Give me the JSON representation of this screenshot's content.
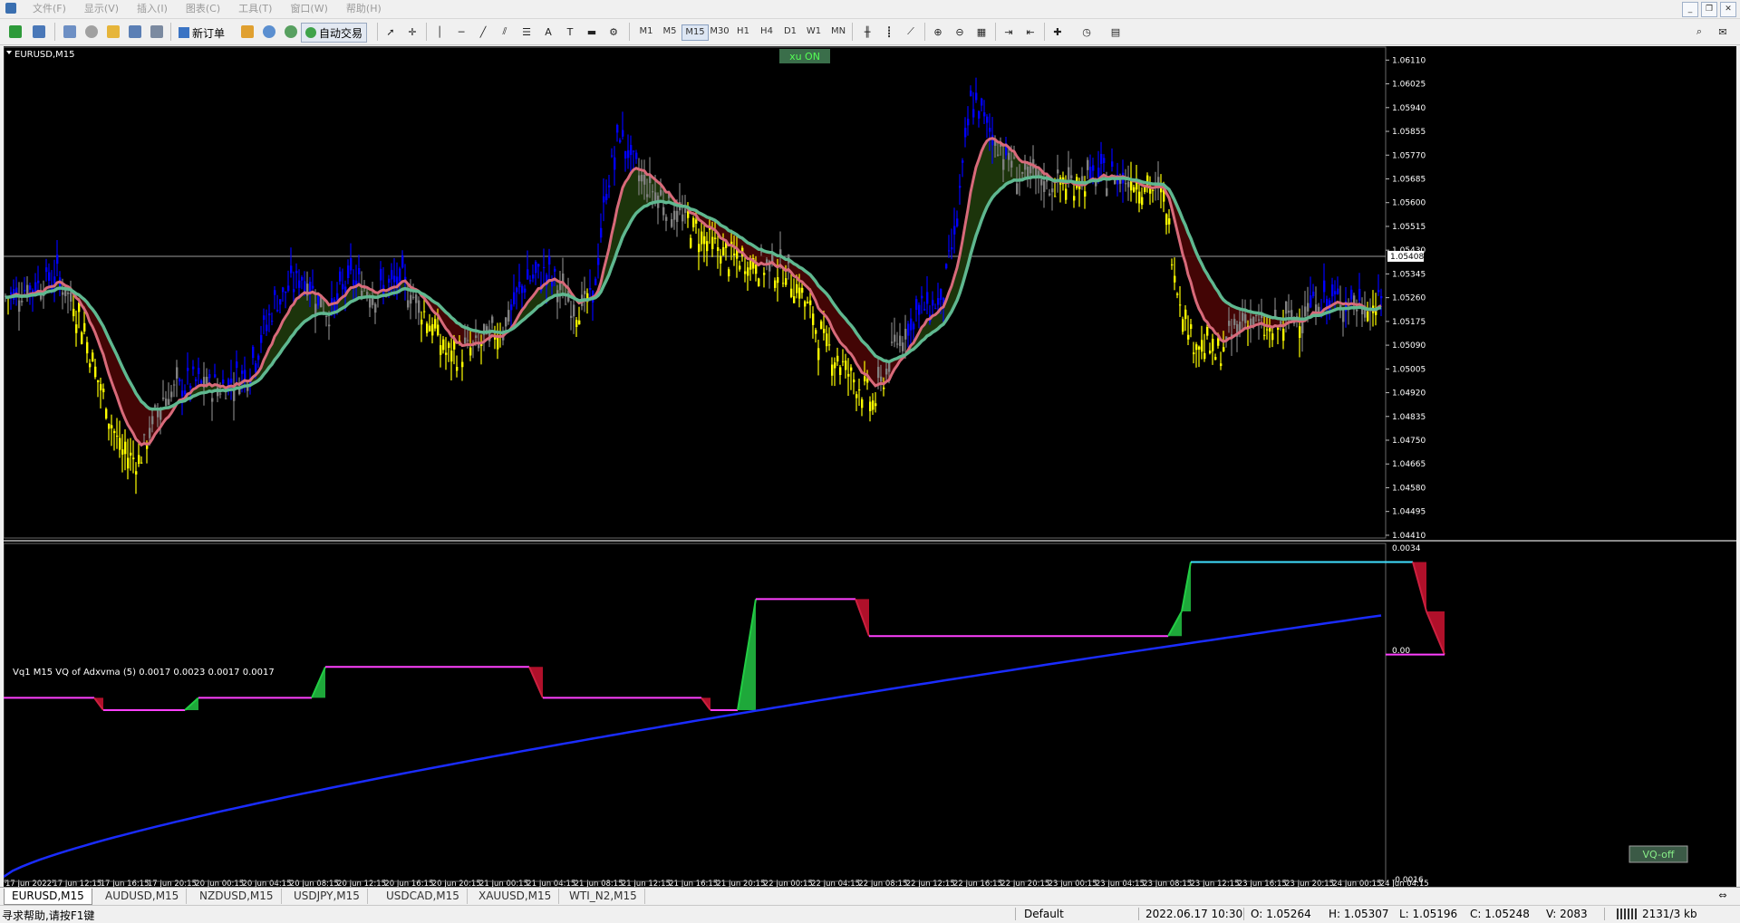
{
  "menu": [
    "文件(F)",
    "显示(V)",
    "插入(I)",
    "图表(C)",
    "工具(T)",
    "窗口(W)",
    "帮助(H)"
  ],
  "toolbar": {
    "new_order": "新订单",
    "auto_trading": "自动交易",
    "timeframes": [
      "M1",
      "M5",
      "M15",
      "M30",
      "H1",
      "H4",
      "D1",
      "W1",
      "MN"
    ],
    "active_timeframe": "M15"
  },
  "chart": {
    "symbol_label": "EURUSD,M15",
    "ea_badge": "xu ON",
    "current_price": "1.05408",
    "price_ticks": [
      "1.06110",
      "1.06025",
      "1.05940",
      "1.05855",
      "1.05770",
      "1.05685",
      "1.05600",
      "1.05515",
      "1.05430",
      "1.05345",
      "1.05260",
      "1.05175",
      "1.05090",
      "1.05005",
      "1.04920",
      "1.04835",
      "1.04750",
      "1.04665",
      "1.04580",
      "1.04495",
      "1.04410"
    ],
    "time_ticks": [
      "17 Jun 2022",
      "17 Jun 12:15",
      "17 Jun 16:15",
      "17 Jun 20:15",
      "20 Jun 00:15",
      "20 Jun 04:15",
      "20 Jun 08:15",
      "20 Jun 12:15",
      "20 Jun 16:15",
      "20 Jun 20:15",
      "21 Jun 00:15",
      "21 Jun 04:15",
      "21 Jun 08:15",
      "21 Jun 12:15",
      "21 Jun 16:15",
      "21 Jun 20:15",
      "22 Jun 00:15",
      "22 Jun 04:15",
      "22 Jun 08:15",
      "22 Jun 12:15",
      "22 Jun 16:15",
      "22 Jun 20:15",
      "23 Jun 00:15",
      "23 Jun 04:15",
      "23 Jun 08:15",
      "23 Jun 12:15",
      "23 Jun 16:15",
      "23 Jun 20:15",
      "24 Jun 00:15",
      "24 Jun 04:15"
    ],
    "colors": {
      "bull": "#0000ff",
      "bear": "#ffff00",
      "neutral": "#808080",
      "fast_ma": "#d86a7a",
      "slow_ma": "#5fb890",
      "fill_up": "#1f3a0c",
      "fill_down": "#4a0606",
      "grid": "#404040"
    }
  },
  "indicator": {
    "label": "Vq1 M15 VQ of Adxvma (5) 0.0017 0.0023 0.0017 0.0017",
    "ticks": [
      "0.0034",
      "0.00",
      "-0.0016"
    ],
    "button": "VQ-off"
  },
  "symbol_tabs": [
    "EURUSD,M15",
    "AUDUSD,M15",
    "NZDUSD,M15",
    "USDJPY,M15",
    "USDCAD,M15",
    "XAUUSD,M15",
    "WTI_N2,M15"
  ],
  "status": {
    "help": "寻求帮助,请按F1键",
    "profile": "Default",
    "datetime": "2022.06.17 10:30",
    "open": "O: 1.05264",
    "high": "H: 1.05307",
    "low": "L: 1.05196",
    "close": "C: 1.05248",
    "volume": "V: 2083",
    "traffic": "2131/3 kb"
  }
}
